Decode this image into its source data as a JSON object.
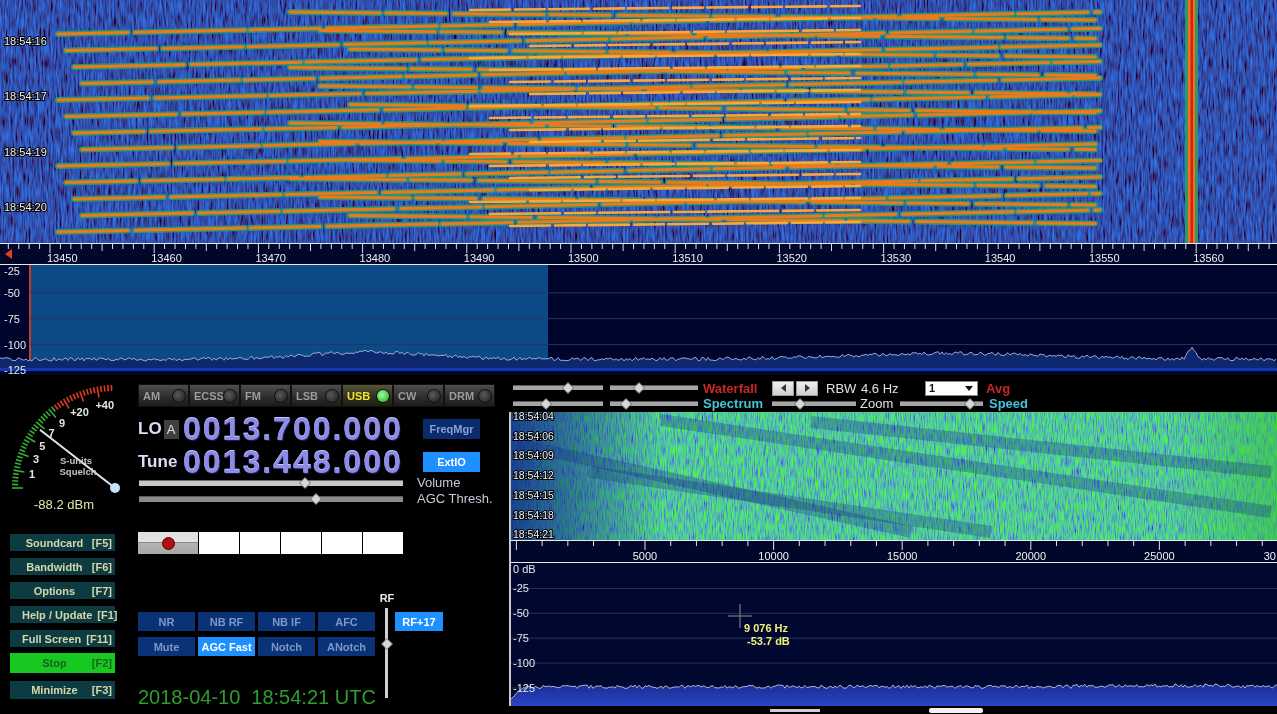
{
  "waterfall": {
    "time_labels": [
      "18:54:16",
      "18:54:17",
      "18:54:19",
      "18:54:20"
    ]
  },
  "frequency_axis": {
    "labels": [
      "13450",
      "13460",
      "13470",
      "13480",
      "13490",
      "13500",
      "13510",
      "13520",
      "13530",
      "13540",
      "13550",
      "13560"
    ]
  },
  "spectrum": {
    "db_labels": [
      "-25",
      "-50",
      "-75",
      "-100",
      "-125"
    ]
  },
  "s_meter": {
    "scale_labels": [
      "1",
      "3",
      "5",
      "7",
      "9",
      "+20",
      "+40"
    ],
    "units_caption": "S-units",
    "squelch_caption": "Squelch",
    "reading": "-88.2 dBm"
  },
  "modes": [
    {
      "label": "AM",
      "selected": false
    },
    {
      "label": "ECSS",
      "selected": false
    },
    {
      "label": "FM",
      "selected": false
    },
    {
      "label": "LSB",
      "selected": false
    },
    {
      "label": "USB",
      "selected": true
    },
    {
      "label": "CW",
      "selected": false
    },
    {
      "label": "DRM",
      "selected": false
    }
  ],
  "lo": {
    "label": "LO",
    "vfo": "A",
    "frequency": "0013.700.000",
    "button": {
      "label": "FreqMgr",
      "active": false
    }
  },
  "tune": {
    "label": "Tune",
    "frequency": "0013.448.000",
    "button": {
      "label": "ExtIO",
      "active": true
    }
  },
  "sliders": [
    {
      "label": "Volume",
      "level": 0.63
    },
    {
      "label": "AGC Thresh.",
      "level": 0.67
    }
  ],
  "function_keys": [
    {
      "label": "Soundcard",
      "key": "[F5]",
      "active": false
    },
    {
      "label": "Bandwidth",
      "key": "[F6]",
      "active": false
    },
    {
      "label": "Options",
      "key": "[F7]",
      "active": false
    },
    {
      "label": "Help / Update",
      "key": "[F1]",
      "active": false
    },
    {
      "label": "Full Screen",
      "key": "[F11]",
      "active": false
    }
  ],
  "run_keys": [
    {
      "label": "Stop",
      "key": "[F2]",
      "active": true
    },
    {
      "label": "Minimize",
      "key": "[F3]",
      "active": false
    }
  ],
  "dsp_buttons": [
    {
      "label": "NR",
      "on": false
    },
    {
      "label": "NB RF",
      "on": false
    },
    {
      "label": "NB IF",
      "on": false
    },
    {
      "label": "AFC",
      "on": false
    },
    {
      "label": "Mute",
      "on": false
    },
    {
      "label": "AGC Fast",
      "on": true
    },
    {
      "label": "Notch",
      "on": false
    },
    {
      "label": "ANotch",
      "on": false
    }
  ],
  "rf_gain": {
    "label": "RF",
    "level": 0.6,
    "readout": "RF+17"
  },
  "clock": {
    "date": "2018-04-10",
    "time": "18:54:21 UTC"
  },
  "display_controls": {
    "waterfall_sliders": [
      {
        "level": 0.61
      },
      {
        "level": 0.33
      }
    ],
    "waterfall_label": "Waterfall",
    "rbw_label": "RBW",
    "rbw_value": "4.6 Hz",
    "average_value": "1",
    "average_label": "Avg",
    "spectrum_sliders": [
      {
        "level": 0.37
      },
      {
        "level": 0.18
      }
    ],
    "spectrum_label": "Spectrum",
    "zoom": {
      "label": "Zoom",
      "level": 0.33
    },
    "speed": {
      "label": "Speed",
      "level": 0.84
    }
  },
  "audio_waterfall": {
    "time_labels": [
      "18:54:04",
      "18:54:06",
      "18:54:09",
      "18:54:12",
      "18:54:15",
      "18:54:18",
      "18:54:21"
    ]
  },
  "audio_axis": {
    "labels": [
      "5000",
      "10000",
      "15000",
      "20000",
      "25000",
      "30"
    ]
  },
  "audio_spectrum": {
    "db_labels": [
      "0 dB",
      "-25",
      "-50",
      "-75",
      "-100",
      "-125"
    ],
    "cursor_frequency": "9 076 Hz",
    "cursor_value": "-53.7 dB"
  }
}
